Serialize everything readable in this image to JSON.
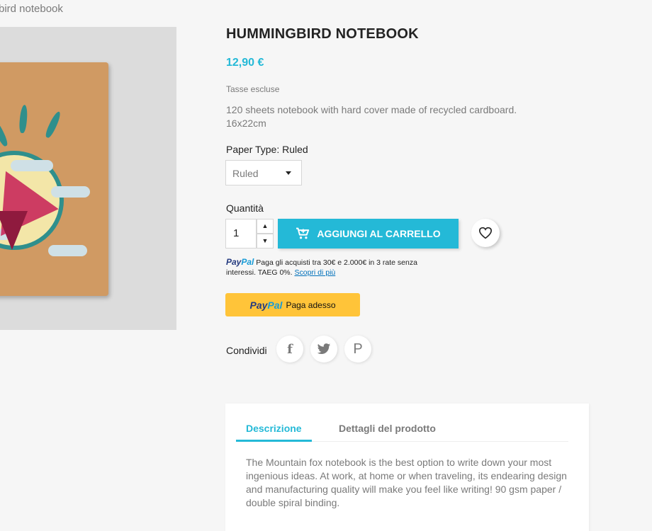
{
  "breadcrumb": {
    "current": "bird notebook"
  },
  "product": {
    "title": "HUMMINGBIRD NOTEBOOK",
    "price": "12,90 €",
    "tax_note": "Tasse escluse",
    "description": "120 sheets notebook with hard cover made of recycled cardboard. 16x22cm"
  },
  "variant": {
    "label": "Paper Type: Ruled",
    "selected": "Ruled"
  },
  "quantity": {
    "label": "Quantità",
    "value": "1",
    "up": "▲",
    "down": "▼"
  },
  "cart": {
    "button_label": "AGGIUNGI AL CARRELLO"
  },
  "paypal": {
    "logo_pay": "Pay",
    "logo_pal": "Pal",
    "message": "Paga gli acquisti tra 30€ e 2.000€ in 3 rate senza interessi. TAEG 0%.",
    "link": "Scopri di più",
    "button_label": "Paga adesso"
  },
  "share": {
    "label": "Condividi",
    "facebook": "f",
    "twitter": "t",
    "pinterest": "P"
  },
  "tabs": {
    "items": [
      {
        "label": "Descrizione"
      },
      {
        "label": "Dettagli del prodotto"
      }
    ],
    "content": "The Mountain fox notebook is the best option to write down your most ingenious ideas. At work, at home or when traveling, its endearing design and manufacturing quality will make you feel like writing! 90 gsm paper / double spiral binding."
  },
  "colors": {
    "accent": "#24b9d7",
    "paypal_yellow": "#ffc439",
    "paypal_blue": "#253b80"
  },
  "icons": {
    "cart": "cart-icon",
    "wishlist": "heart-icon",
    "select": "chevron-down-icon"
  }
}
